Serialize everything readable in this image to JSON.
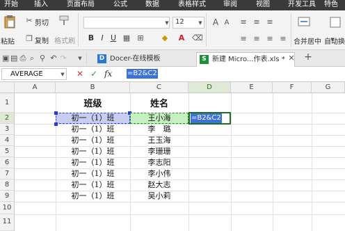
{
  "menu": {
    "tabs": [
      "开始",
      "插入",
      "页面布局",
      "公式",
      "数据",
      "表格样式",
      "审阅",
      "视图",
      "开发工具",
      "特色"
    ]
  },
  "toolbar": {
    "paste_label": "粘贴",
    "cut_label": "剪切",
    "copy_label": "复制",
    "format_painter_label": "格式刷",
    "font_size": "12",
    "merge_center_label": "合并居中",
    "auto_wrap_label": "自动换"
  },
  "doc_tabs": [
    {
      "label": "Docer-在线模板",
      "badge": "D"
    },
    {
      "label": "新建 Micro...作表.xls *",
      "badge": "S"
    }
  ],
  "formula_bar": {
    "name_box": "AVERAGE",
    "formula": "=B2&C2",
    "fx_label": "fx"
  },
  "grid": {
    "columns": [
      "A",
      "B",
      "C",
      "D",
      "E",
      "F",
      "G"
    ],
    "rows": [
      "1",
      "2",
      "3",
      "4",
      "5",
      "6",
      "7",
      "8",
      "9",
      "10",
      "11"
    ],
    "headers": {
      "class": "班级",
      "name": "姓名"
    },
    "class_values": [
      "初一（1）班",
      "初一（1）班",
      "初一（1）班",
      "初一（1）班",
      "初一（1）班",
      "初一（1）班",
      "初一（1）班",
      "初一（1）班"
    ],
    "name_values": [
      "王小海",
      "李　璐",
      "王玉海",
      "李珊珊",
      "李志阳",
      "李小伟",
      "赵大志",
      "吴小莉"
    ],
    "editing_cell_text": "=B2&C2"
  },
  "colors": {
    "accent_formula": "#3b73d9",
    "ref_b2": "#c9cdf2",
    "ref_c2": "#c7f0c2",
    "active_border": "#1e6e1e"
  }
}
